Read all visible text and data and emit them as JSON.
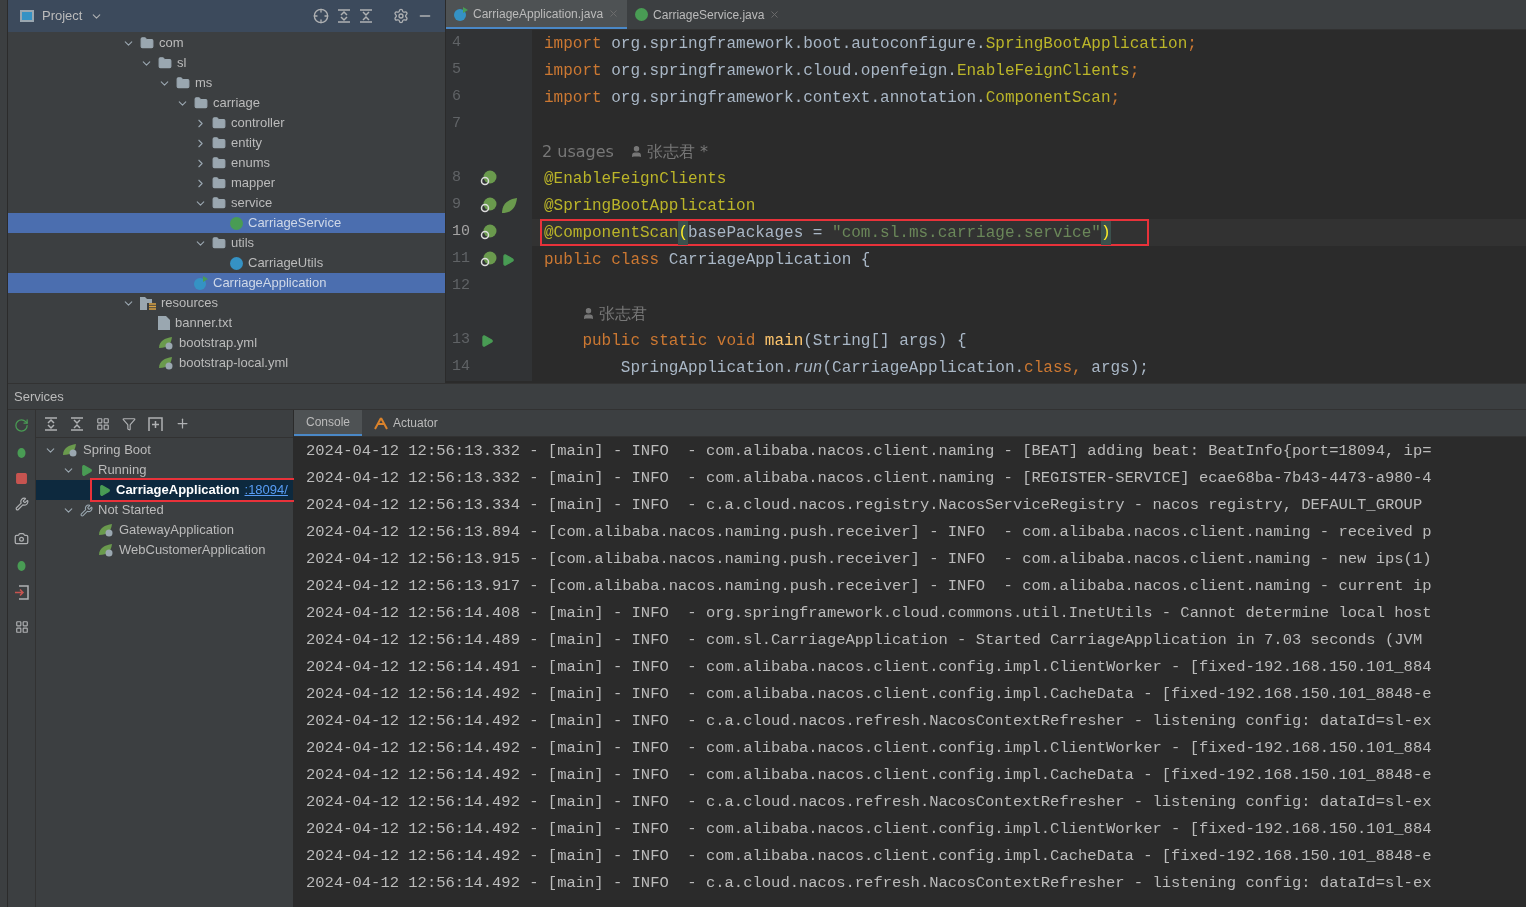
{
  "project_panel": {
    "title": "Project",
    "tree": [
      {
        "label": "com",
        "kind": "package",
        "expanded": true,
        "selected": false,
        "children": [
          {
            "label": "sl",
            "kind": "package",
            "expanded": true,
            "selected": false,
            "children": [
              {
                "label": "ms",
                "kind": "package",
                "expanded": true,
                "selected": false,
                "children": [
                  {
                    "label": "carriage",
                    "kind": "package",
                    "expanded": true,
                    "selected": false,
                    "children": [
                      {
                        "label": "controller",
                        "kind": "package",
                        "expanded": false,
                        "selected": false
                      },
                      {
                        "label": "entity",
                        "kind": "package",
                        "expanded": false,
                        "selected": false
                      },
                      {
                        "label": "enums",
                        "kind": "package",
                        "expanded": false,
                        "selected": false
                      },
                      {
                        "label": "mapper",
                        "kind": "package",
                        "expanded": false,
                        "selected": false
                      },
                      {
                        "label": "service",
                        "kind": "package",
                        "expanded": true,
                        "selected": false,
                        "children": [
                          {
                            "label": "CarriageService",
                            "kind": "interface",
                            "selected": true
                          }
                        ]
                      },
                      {
                        "label": "utils",
                        "kind": "package",
                        "expanded": true,
                        "selected": false,
                        "children": [
                          {
                            "label": "CarriageUtils",
                            "kind": "class",
                            "selected": false
                          }
                        ]
                      }
                    ]
                  },
                  {
                    "label": "CarriageApplication",
                    "kind": "spring-class",
                    "selected": true
                  }
                ]
              }
            ]
          }
        ]
      },
      {
        "label": "resources",
        "kind": "resources",
        "expanded": true,
        "selected": false,
        "children": [
          {
            "label": "banner.txt",
            "kind": "text",
            "selected": false
          },
          {
            "label": "bootstrap.yml",
            "kind": "spring-config",
            "selected": false
          },
          {
            "label": "bootstrap-local.yml",
            "kind": "spring-config",
            "selected": false
          }
        ]
      }
    ]
  },
  "editor": {
    "tabs": [
      {
        "label": "CarriageApplication.java",
        "kind": "spring-class",
        "selected": true
      },
      {
        "label": "CarriageService.java",
        "kind": "interface",
        "selected": false
      }
    ],
    "lines": [
      {
        "kind": "code",
        "number": "4",
        "current": false,
        "boxed": false,
        "tokens": [
          {
            "text": "import",
            "kind": "keyword"
          },
          {
            "text": " org.springframework.boot.autoconfigure.",
            "kind": "plain"
          },
          {
            "text": "SpringBootApplication",
            "kind": "annotation"
          },
          {
            "text": ";",
            "kind": "keyword"
          }
        ]
      },
      {
        "kind": "code",
        "number": "5",
        "current": false,
        "boxed": false,
        "tokens": [
          {
            "text": "import",
            "kind": "keyword"
          },
          {
            "text": " org.springframework.cloud.openfeign.",
            "kind": "plain"
          },
          {
            "text": "EnableFeignClients",
            "kind": "annotation"
          },
          {
            "text": ";",
            "kind": "keyword"
          }
        ]
      },
      {
        "kind": "code",
        "number": "6",
        "current": false,
        "boxed": false,
        "tokens": [
          {
            "text": "import",
            "kind": "keyword"
          },
          {
            "text": " org.springframework.context.annotation.",
            "kind": "plain"
          },
          {
            "text": "ComponentScan",
            "kind": "annotation"
          },
          {
            "text": ";",
            "kind": "keyword"
          }
        ]
      },
      {
        "kind": "code",
        "number": "7",
        "current": false
      },
      {
        "kind": "hint",
        "usages": "2 usages",
        "author": "张志君 *"
      },
      {
        "kind": "code",
        "number": "8",
        "current": false,
        "boxed": false,
        "gutter": [
          {
            "kind": "bean"
          }
        ],
        "tokens": [
          {
            "text": "@EnableFeignClients",
            "kind": "annotation"
          }
        ]
      },
      {
        "kind": "code",
        "number": "9",
        "current": false,
        "boxed": false,
        "gutter": [
          {
            "kind": "bean"
          },
          {
            "kind": "spring"
          }
        ],
        "tokens": [
          {
            "text": "@SpringBootApplication",
            "kind": "annotation"
          }
        ]
      },
      {
        "kind": "code",
        "number": "10",
        "current": true,
        "boxed": true,
        "gutter": [
          {
            "kind": "bean"
          }
        ],
        "tokens": [
          {
            "text": "@ComponentScan",
            "kind": "annotation"
          },
          {
            "text": "(",
            "kind": "bracket"
          },
          {
            "text": "basePackages = ",
            "kind": "plain"
          },
          {
            "text": "\"com.sl.ms.carriage.service\"",
            "kind": "string"
          },
          {
            "text": ")",
            "kind": "bracket"
          }
        ]
      },
      {
        "kind": "code",
        "number": "11",
        "current": false,
        "boxed": false,
        "gutter": [
          {
            "kind": "bean"
          },
          {
            "kind": "run"
          }
        ],
        "tokens": [
          {
            "text": "public class ",
            "kind": "keyword"
          },
          {
            "text": "CarriageApplication {",
            "kind": "plain"
          }
        ]
      },
      {
        "kind": "code",
        "number": "12",
        "current": false
      },
      {
        "kind": "hint",
        "author": "张志君"
      },
      {
        "kind": "code",
        "number": "13",
        "current": false,
        "boxed": false,
        "gutter": [
          {
            "kind": "run"
          }
        ],
        "tokens": [
          {
            "text": "    public static void ",
            "kind": "keyword"
          },
          {
            "text": "main",
            "kind": "method"
          },
          {
            "text": "(String[] args) {",
            "kind": "plain"
          }
        ]
      },
      {
        "kind": "code",
        "number": "14",
        "current": false,
        "boxed": false,
        "tokens": [
          {
            "text": "        SpringApplication.",
            "kind": "plain"
          },
          {
            "text": "run",
            "kind": "italic"
          },
          {
            "text": "(CarriageApplication.",
            "kind": "plain"
          },
          {
            "text": "class",
            "kind": "keyword"
          },
          {
            "text": ", ",
            "kind": "keyword"
          },
          {
            "text": "args);",
            "kind": "plain"
          }
        ]
      }
    ]
  },
  "services": {
    "title": "Services",
    "tree": [
      {
        "label": "Spring Boot",
        "kind": "spring",
        "expanded": true,
        "selected": false,
        "children": [
          {
            "label": "Running",
            "kind": "run",
            "expanded": true,
            "selected": false,
            "children": [
              {
                "label": "CarriageApplication",
                "link": ":18094/",
                "kind": "run",
                "selected": true,
                "boxed": true
              }
            ]
          },
          {
            "label": "Not Started",
            "kind": "wrench",
            "expanded": true,
            "selected": false,
            "children": [
              {
                "label": "GatewayApplication",
                "kind": "spring",
                "selected": false,
                "boxed": false
              },
              {
                "label": "WebCustomerApplication",
                "kind": "spring",
                "selected": false,
                "boxed": false
              }
            ]
          }
        ]
      }
    ],
    "console_tabs": [
      {
        "label": "Console",
        "kind": "plain",
        "selected": true
      },
      {
        "label": "Actuator",
        "kind": "actuator",
        "selected": false
      }
    ],
    "console_lines": [
      "2024-04-12 12:56:13.332 - [main] - INFO  - com.alibaba.nacos.client.naming - [BEAT] adding beat: BeatInfo{port=18094, ip=",
      "2024-04-12 12:56:13.332 - [main] - INFO  - com.alibaba.nacos.client.naming - [REGISTER-SERVICE] ecae68ba-7b43-4473-a980-4",
      "2024-04-12 12:56:13.334 - [main] - INFO  - c.a.cloud.nacos.registry.NacosServiceRegistry - nacos registry, DEFAULT_GROUP",
      "2024-04-12 12:56:13.894 - [com.alibaba.nacos.naming.push.receiver] - INFO  - com.alibaba.nacos.client.naming - received p",
      "2024-04-12 12:56:13.915 - [com.alibaba.nacos.naming.push.receiver] - INFO  - com.alibaba.nacos.client.naming - new ips(1)",
      "2024-04-12 12:56:13.917 - [com.alibaba.nacos.naming.push.receiver] - INFO  - com.alibaba.nacos.client.naming - current ip",
      "2024-04-12 12:56:14.408 - [main] - INFO  - org.springframework.cloud.commons.util.InetUtils - Cannot determine local host",
      "2024-04-12 12:56:14.489 - [main] - INFO  - com.sl.CarriageApplication - Started CarriageApplication in 7.03 seconds (JVM",
      "2024-04-12 12:56:14.491 - [main] - INFO  - com.alibaba.nacos.client.config.impl.ClientWorker - [fixed-192.168.150.101_884",
      "2024-04-12 12:56:14.492 - [main] - INFO  - com.alibaba.nacos.client.config.impl.CacheData - [fixed-192.168.150.101_8848-e",
      "2024-04-12 12:56:14.492 - [main] - INFO  - c.a.cloud.nacos.refresh.NacosContextRefresher - listening config: dataId=sl-ex",
      "2024-04-12 12:56:14.492 - [main] - INFO  - com.alibaba.nacos.client.config.impl.ClientWorker - [fixed-192.168.150.101_884",
      "2024-04-12 12:56:14.492 - [main] - INFO  - com.alibaba.nacos.client.config.impl.CacheData - [fixed-192.168.150.101_8848-e",
      "2024-04-12 12:56:14.492 - [main] - INFO  - c.a.cloud.nacos.refresh.NacosContextRefresher - listening config: dataId=sl-ex",
      "2024-04-12 12:56:14.492 - [main] - INFO  - com.alibaba.nacos.client.config.impl.ClientWorker - [fixed-192.168.150.101_884",
      "2024-04-12 12:56:14.492 - [main] - INFO  - com.alibaba.nacos.client.config.impl.CacheData - [fixed-192.168.150.101_8848-e",
      "2024-04-12 12:56:14.492 - [main] - INFO  - c.a.cloud.nacos.refresh.NacosContextRefresher - listening config: dataId=sl-ex"
    ]
  }
}
